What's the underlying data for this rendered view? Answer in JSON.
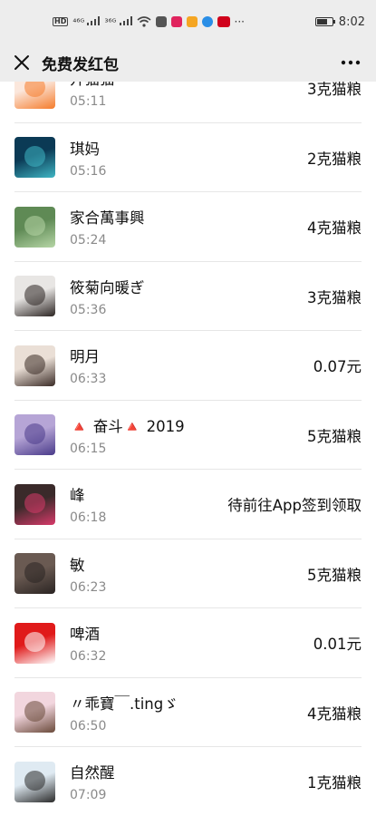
{
  "status_bar": {
    "network_hd": "HD",
    "signal1": "⁴⁶ᴳ",
    "signal2": "³⁶ᴳ",
    "more": "···",
    "time": "8:02",
    "battery_level": 0.7
  },
  "nav": {
    "title": "免费发红包",
    "close_icon": "close-icon",
    "more_icon": "more-icon"
  },
  "list": [
    {
      "name": "开猫猫",
      "time": "05:11",
      "amount": "3克猫粮",
      "avatar_colors": [
        "#fbe7dc",
        "#f57c2b"
      ]
    },
    {
      "name": "琪妈",
      "time": "05:16",
      "amount": "2克猫粮",
      "avatar_colors": [
        "#0b3a55",
        "#3fb6c4"
      ]
    },
    {
      "name": "家合萬事興",
      "time": "05:24",
      "amount": "4克猫粮",
      "avatar_colors": [
        "#5f8a55",
        "#b6d6a6"
      ]
    },
    {
      "name": "筱菊向暖ぎ",
      "time": "05:36",
      "amount": "3克猫粮",
      "avatar_colors": [
        "#e8e6e4",
        "#2b2422"
      ]
    },
    {
      "name": "明月",
      "time": "06:33",
      "amount": "0.07元",
      "avatar_colors": [
        "#eadfd6",
        "#3a2b26"
      ]
    },
    {
      "name": "🔺 奋斗🔺 2019",
      "time": "06:15",
      "amount": "5克猫粮",
      "avatar_colors": [
        "#b6a5d6",
        "#4a3b8a"
      ]
    },
    {
      "name": "峰",
      "time": "06:18",
      "amount": "待前往App签到领取",
      "avatar_colors": [
        "#3a2a2a",
        "#d83a6a"
      ]
    },
    {
      "name": "敏",
      "time": "06:23",
      "amount": "5克猫粮",
      "avatar_colors": [
        "#6a5a52",
        "#2a2422"
      ]
    },
    {
      "name": "啤酒",
      "time": "06:32",
      "amount": "0.01元",
      "avatar_colors": [
        "#e01a1a",
        "#ffffff"
      ]
    },
    {
      "name": "〃乖寶￣.tingゞ",
      "time": "06:50",
      "amount": "4克猫粮",
      "avatar_colors": [
        "#f2d6de",
        "#6a4a3a"
      ]
    },
    {
      "name": "自然醒",
      "time": "07:09",
      "amount": "1克猫粮",
      "avatar_colors": [
        "#dfeaf2",
        "#2a2a2a"
      ]
    }
  ]
}
